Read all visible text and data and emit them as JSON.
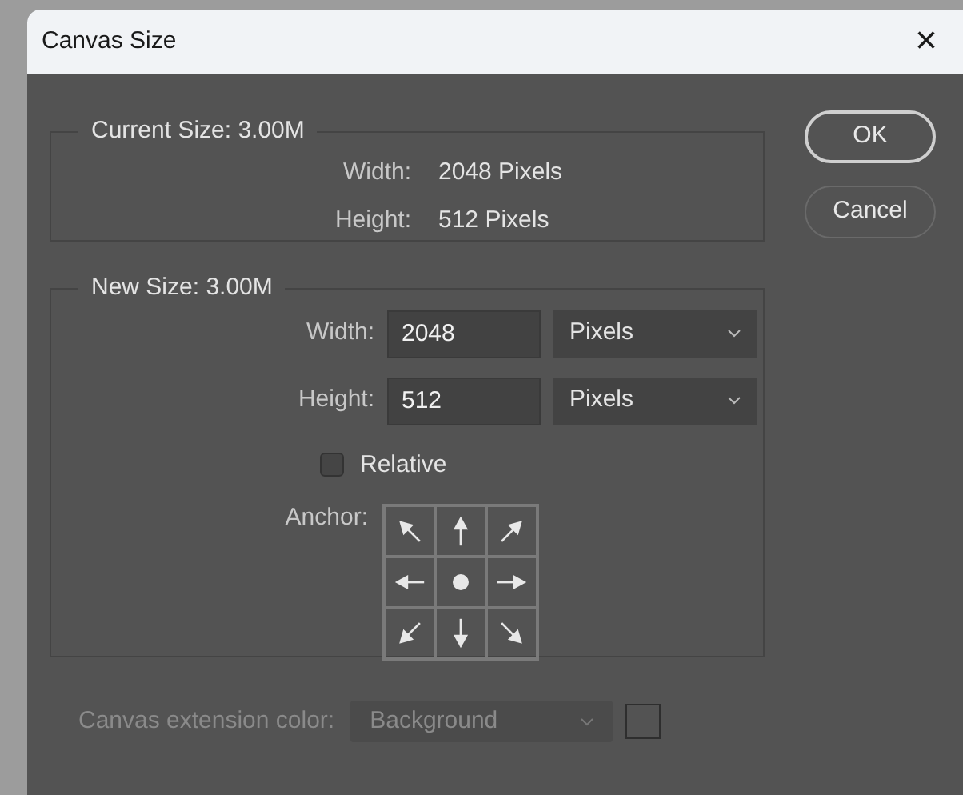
{
  "window": {
    "title": "Canvas Size",
    "close": "×"
  },
  "current_size": {
    "legend": "Current Size: 3.00M",
    "rows": [
      {
        "label": "Width:",
        "value": "2048 Pixels"
      },
      {
        "label": "Height:",
        "value": "512 Pixels"
      }
    ]
  },
  "buttons": [
    {
      "label": "OK",
      "default": true
    },
    {
      "label": "Cancel",
      "default": false
    }
  ],
  "new_size": {
    "legend": "New Size: 3.00M",
    "rows": [
      {
        "label": "Width:",
        "value": "2048",
        "unit": "Pixels"
      },
      {
        "label": "Height:",
        "value": "512",
        "unit": "Pixels"
      }
    ],
    "relative": {
      "label": "Relative",
      "checked": false
    },
    "anchor": {
      "label": "Anchor:",
      "cells": [
        {
          "selected": false
        },
        {
          "selected": false
        },
        {
          "selected": false
        },
        {
          "selected": false
        },
        {
          "selected": true
        },
        {
          "selected": false
        },
        {
          "selected": false
        },
        {
          "selected": false
        },
        {
          "selected": false
        }
      ]
    }
  },
  "extension_color": {
    "label": "Canvas extension color:",
    "value": "Background",
    "disabled": true
  }
}
